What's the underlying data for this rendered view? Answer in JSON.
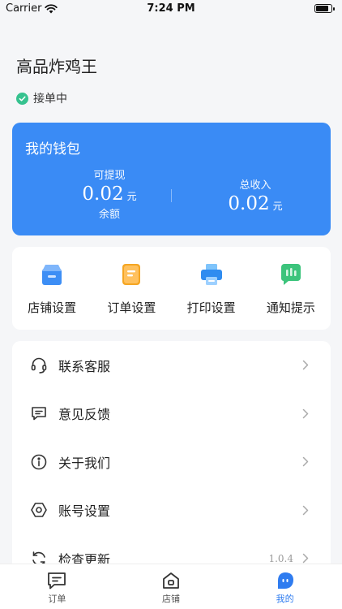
{
  "status_bar": {
    "carrier": "Carrier",
    "time": "7:24 PM",
    "battery_level": 0.85
  },
  "header": {
    "store_name": "高品炸鸡王",
    "status": "接单中"
  },
  "wallet": {
    "title": "我的钱包",
    "withdrawable_label": "可提现",
    "withdrawable_amount": "0.02",
    "withdrawable_unit": "元",
    "balance_label": "余额",
    "total_income_label": "总收入",
    "total_income_amount": "0.02",
    "total_income_unit": "元",
    "colors": {
      "background": "#3a8bf5"
    }
  },
  "quick_actions": [
    {
      "label": "店铺设置",
      "icon": "store-icon"
    },
    {
      "label": "订单设置",
      "icon": "order-doc-icon"
    },
    {
      "label": "打印设置",
      "icon": "printer-icon"
    },
    {
      "label": "通知提示",
      "icon": "chat-notice-icon"
    }
  ],
  "menu": [
    {
      "label": "联系客服",
      "icon": "headset-icon",
      "value": ""
    },
    {
      "label": "意见反馈",
      "icon": "feedback-icon",
      "value": ""
    },
    {
      "label": "关于我们",
      "icon": "info-icon",
      "value": ""
    },
    {
      "label": "账号设置",
      "icon": "hex-settings-icon",
      "value": ""
    },
    {
      "label": "检查更新",
      "icon": "refresh-icon",
      "value": "1.0.4"
    }
  ],
  "tabbar": {
    "items": [
      {
        "label": "订单",
        "icon": "chat-bubble-icon"
      },
      {
        "label": "店铺",
        "icon": "home-icon"
      },
      {
        "label": "我的",
        "icon": "profile-blob-icon"
      }
    ],
    "active_index": 2,
    "colors": {
      "active": "#2f7cf0"
    }
  }
}
